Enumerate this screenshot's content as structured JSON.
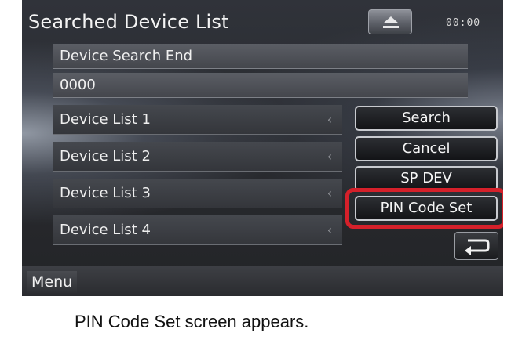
{
  "screen": {
    "title": "Searched Device List",
    "clock": "00:00",
    "eject_icon": "eject-icon",
    "status_text": "Device Search End",
    "pin_value": "0000"
  },
  "device_list": {
    "items": [
      {
        "label": "Device List 1"
      },
      {
        "label": "Device List 2"
      },
      {
        "label": "Device List 3"
      },
      {
        "label": "Device List 4"
      }
    ],
    "chevron": "‹"
  },
  "buttons": {
    "search": "Search",
    "cancel": "Cancel",
    "sp_dev": "SP DEV",
    "pin_code_set": "PIN Code Set"
  },
  "highlight_color": "#d5202a",
  "back_icon": "return-arrow-icon",
  "bottom_bar": {
    "menu_label": "Menu"
  },
  "caption": "PIN Code Set screen appears."
}
